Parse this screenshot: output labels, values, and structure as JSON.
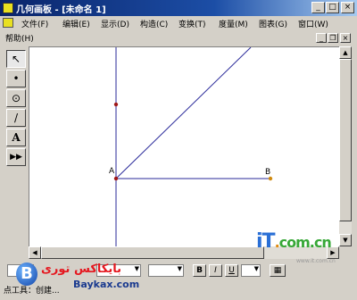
{
  "window": {
    "title": "几何画板 - [未命名 1]",
    "minimize_glyph": "_",
    "maximize_glyph": "□",
    "close_glyph": "×"
  },
  "menu": {
    "items": [
      "文件(F)",
      "编辑(E)",
      "显示(D)",
      "构造(C)",
      "变换(T)",
      "度量(M)",
      "图表(G)",
      "窗口(W)"
    ],
    "help": "帮助(H)"
  },
  "mdi_controls": {
    "minimize": "_",
    "restore": "❐",
    "close": "×"
  },
  "toolbox": {
    "tools": [
      {
        "name": "arrow-select",
        "glyph": "↖"
      },
      {
        "name": "point",
        "glyph": "•"
      },
      {
        "name": "compass",
        "glyph": "⊙"
      },
      {
        "name": "straightedge",
        "glyph": "/"
      },
      {
        "name": "text",
        "glyph": "A"
      },
      {
        "name": "custom",
        "glyph": "▶▶"
      }
    ]
  },
  "canvas": {
    "point_a_label": "A",
    "point_b_label": "B",
    "colors": {
      "line": "#2a2a9a",
      "point": "#a01818",
      "point_b": "#d08a10"
    }
  },
  "format_bar": {
    "bold": "B",
    "italic": "I",
    "underline": "U"
  },
  "status": {
    "text": "点工具：创建..."
  },
  "watermark": {
    "logo_text": "بایکاکس توری",
    "url": "Baykax.com",
    "it_text": "iT.com.cn",
    "it_sub": "www.it.com.cn"
  }
}
